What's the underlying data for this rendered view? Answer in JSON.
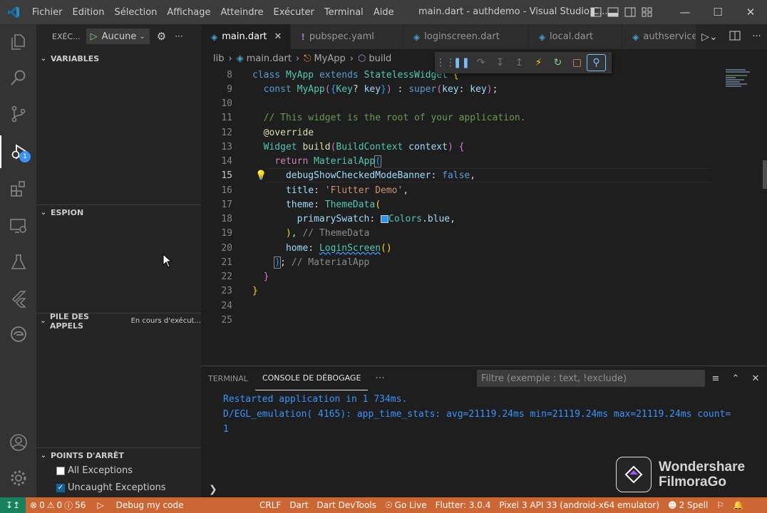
{
  "titlebar": {
    "menu": [
      "Fichier",
      "Edition",
      "Sélection",
      "Affichage",
      "Atteindre",
      "Exécuter",
      "Terminal",
      "Aide"
    ],
    "title": "main.dart - authdemo - Visual Studio C..."
  },
  "activitybar": {
    "items": [
      "explorer-icon",
      "search-icon",
      "source-control-icon",
      "run-debug-icon",
      "extensions-icon",
      "remote-explorer-icon",
      "testing-icon",
      "flutter-icon",
      "edge-icon"
    ],
    "debug_badge": "1",
    "bottom": [
      "accounts-icon",
      "manage-gear-icon"
    ]
  },
  "sidebar": {
    "run_label": "EXÉC...",
    "config_value": "Aucune",
    "sections": {
      "variables": "VARIABLES",
      "watch": "ESPION",
      "callstack": "PILE DES APPELS",
      "callstack_status": "En cours d'exécut...",
      "breakpoints": "POINTS D'ARRÊT"
    },
    "breakpoints": [
      {
        "label": "All Exceptions",
        "checked": false
      },
      {
        "label": "Uncaught Exceptions",
        "checked": true
      }
    ]
  },
  "tabs": [
    {
      "label": "main.dart",
      "active": true,
      "icon": "dart-icon"
    },
    {
      "label": "pubspec.yaml",
      "active": false,
      "icon": "yaml-icon"
    },
    {
      "label": "loginscreen.dart",
      "active": false,
      "icon": "dart-icon"
    },
    {
      "label": "local.dart",
      "active": false,
      "icon": "dart-icon"
    },
    {
      "label": "authservice.da",
      "active": false,
      "icon": "dart-icon"
    }
  ],
  "breadcrumb": [
    "lib",
    "main.dart",
    "MyApp",
    "build"
  ],
  "editor": {
    "line_numbers": [
      "8",
      "9",
      "10",
      "11",
      "12",
      "13",
      "14",
      "15",
      "16",
      "17",
      "18",
      "19",
      "20",
      "21",
      "22",
      "23",
      "24",
      "25"
    ],
    "current_line": "15",
    "lines": [
      "class MyApp extends StatelessWidget {",
      "  const MyApp({Key? key}) : super(key: key);",
      "",
      "  // This widget is the root of your application.",
      "  @override",
      "  Widget build(BuildContext context) {",
      "    return MaterialApp(",
      "      debugShowCheckedModeBanner: false,",
      "      title: 'Flutter Demo',",
      "      theme: ThemeData(",
      "        primarySwatch: Colors.blue,",
      "      ), // ThemeData",
      "      home: LoginScreen()",
      "    ); // MaterialApp",
      "  }",
      "}",
      "",
      ""
    ]
  },
  "panel": {
    "tabs": [
      "TERMINAL",
      "CONSOLE DE DÉBOGAGE"
    ],
    "active_tab": "CONSOLE DE DÉBOGAGE",
    "filter_placeholder": "Filtre (exemple : text, !exclude)",
    "output": [
      "Restarted application in 1 734ms.",
      "D/EGL_emulation( 4165): app_time_stats: avg=21119.24ms min=21119.24ms max=21119.24ms count=",
      "1"
    ]
  },
  "watermark": {
    "line1": "Wondershare",
    "line2": "FilmoraGo"
  },
  "statusbar": {
    "errors": "0",
    "warnings": "0",
    "infos": "56",
    "debug": "Debug my code",
    "eol": "CRLF",
    "lang": "Dart",
    "devtools": "Dart DevTools",
    "golive": "Go Live",
    "flutter": "Flutter: 3.0.4",
    "device": "Pixel 3 API 33 (android-x64 emulator)",
    "spell": "2 Spell",
    "colors": {
      "bar": "#cc6633",
      "remote": "#16825d"
    }
  },
  "colors": {
    "accent": "#3794ff",
    "editor_bg": "#1e1e1e",
    "sidebar_bg": "#252526"
  }
}
